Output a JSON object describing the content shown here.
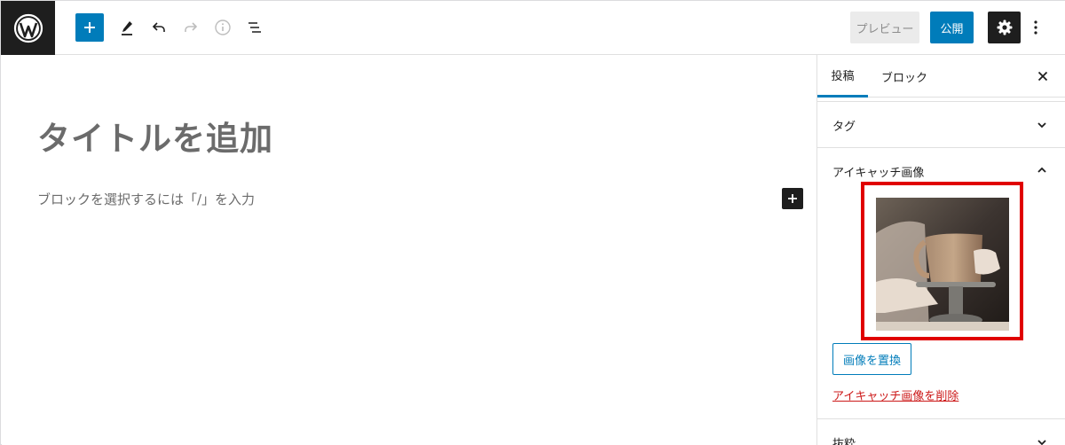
{
  "toolbar": {
    "preview_label": "プレビュー",
    "publish_label": "公開"
  },
  "editor": {
    "title_placeholder": "タイトルを追加",
    "block_placeholder": "ブロックを選択するには「/」を入力"
  },
  "sidebar": {
    "tabs": [
      {
        "label": "投稿"
      },
      {
        "label": "ブロック"
      }
    ],
    "panels": {
      "tags": {
        "title": "タグ"
      },
      "featured_image": {
        "title": "アイキャッチ画像",
        "replace_label": "画像を置換",
        "remove_label": "アイキャッチ画像を削除"
      },
      "excerpt": {
        "title": "抜粋"
      }
    }
  },
  "colors": {
    "accent": "#007cba",
    "dark": "#1e1e1e",
    "highlight_border": "#e00000",
    "danger": "#cc1818"
  },
  "icons": [
    "wordpress-logo-icon",
    "plus-icon",
    "pencil-icon",
    "undo-icon",
    "redo-icon",
    "info-icon",
    "list-view-icon",
    "gear-icon",
    "more-vertical-icon",
    "close-icon",
    "chevron-down-icon",
    "chevron-up-icon"
  ]
}
